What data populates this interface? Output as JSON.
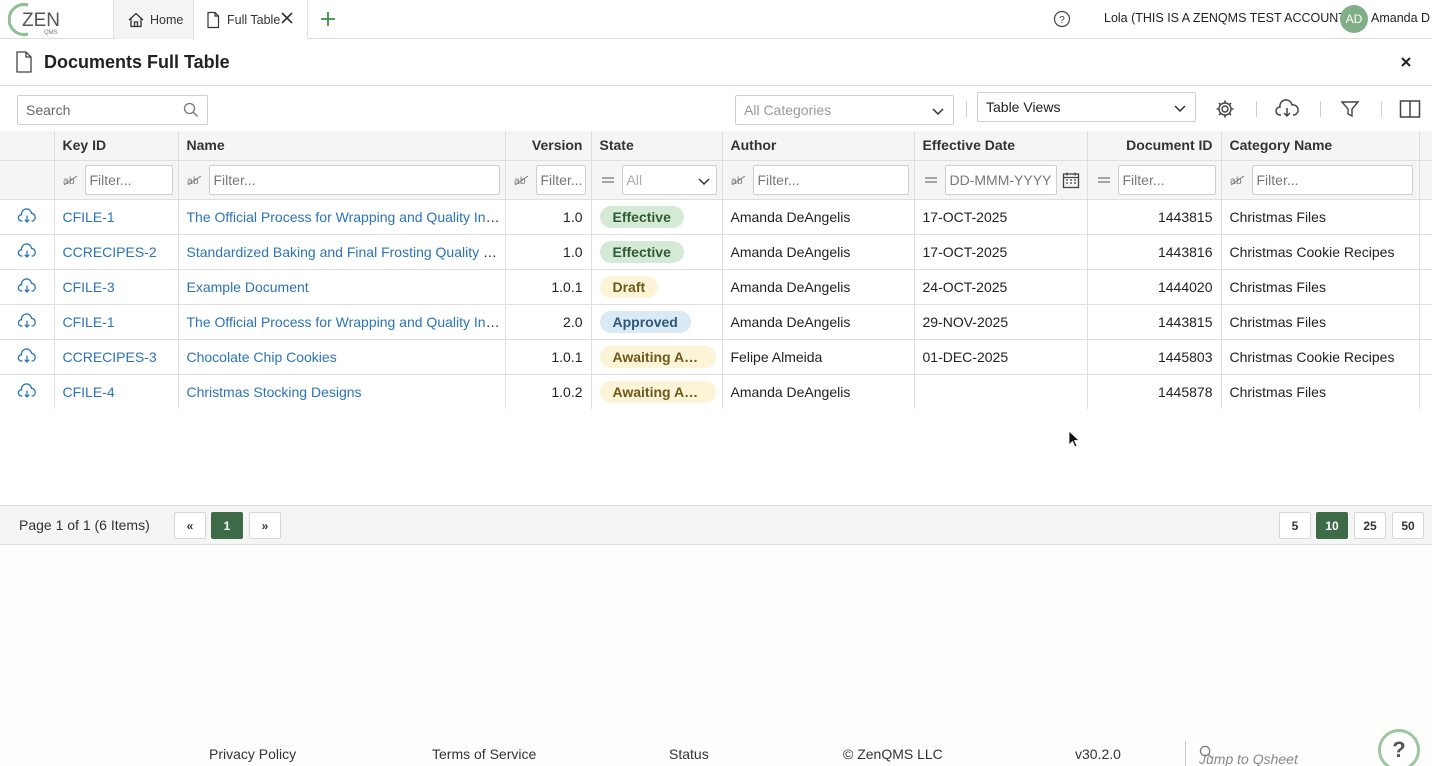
{
  "topbar": {
    "logo_text": "ZEN",
    "logo_sub": "QMS",
    "tabs": [
      {
        "label": "Home",
        "icon": "home-icon"
      },
      {
        "label": "Full Table",
        "icon": "document-icon"
      }
    ],
    "account": "Lola (THIS IS A ZENQMS TEST ACCOUNT)",
    "avatar_initials": "AD",
    "username": "Amanda D"
  },
  "page": {
    "title": "Documents Full Table"
  },
  "toolbar": {
    "search_placeholder": "Search",
    "categories_placeholder": "All Categories",
    "table_views_label": "Table Views"
  },
  "grid": {
    "columns": [
      "Key ID",
      "Name",
      "Version",
      "State",
      "Author",
      "Effective Date",
      "Document ID",
      "Category Name"
    ],
    "filters": {
      "text_placeholder": "Filter...",
      "state_placeholder": "All",
      "date_placeholder": "DD-MMM-YYYY"
    },
    "rows": [
      {
        "key_id": "CFILE-1",
        "name": "The Official Process for Wrapping and Quality Inspection of Christmas Gifts",
        "version": "1.0",
        "state": "Effective",
        "author": "Amanda DeAngelis",
        "effective_date": "17-OCT-2025",
        "document_id": "1443815",
        "category": "Christmas Files"
      },
      {
        "key_id": "CCRECIPES-2",
        "name": "Standardized Baking and Final Frosting Quality Check",
        "version": "1.0",
        "state": "Effective",
        "author": "Amanda DeAngelis",
        "effective_date": "17-OCT-2025",
        "document_id": "1443816",
        "category": "Christmas Cookie Recipes"
      },
      {
        "key_id": "CFILE-3",
        "name": "Example Document",
        "version": "1.0.1",
        "state": "Draft",
        "author": "Amanda DeAngelis",
        "effective_date": "24-OCT-2025",
        "document_id": "1444020",
        "category": "Christmas Files"
      },
      {
        "key_id": "CFILE-1",
        "name": "The Official Process for Wrapping and Quality Inspection of Christmas Gifts",
        "version": "2.0",
        "state": "Approved",
        "author": "Amanda DeAngelis",
        "effective_date": "29-NOV-2025",
        "document_id": "1443815",
        "category": "Christmas Files"
      },
      {
        "key_id": "CCRECIPES-3",
        "name": "Chocolate Chip Cookies",
        "version": "1.0.1",
        "state": "Awaiting Approval",
        "author": "Felipe Almeida",
        "effective_date": "01-DEC-2025",
        "document_id": "1445803",
        "category": "Christmas Cookie Recipes"
      },
      {
        "key_id": "CFILE-4",
        "name": "Christmas Stocking Designs",
        "version": "1.0.2",
        "state": "Awaiting Approval",
        "author": "Amanda DeAngelis",
        "effective_date": "",
        "document_id": "1445878",
        "category": "Christmas Files"
      }
    ],
    "state_colors": {
      "Effective": {
        "bg": "#d5ead6",
        "fg": "#2e5a35"
      },
      "Draft": {
        "bg": "#fbf4d6",
        "fg": "#6b5a1c"
      },
      "Approved": {
        "bg": "#d9e9f6",
        "fg": "#2d5878"
      },
      "Awaiting Approval": {
        "bg": "#fbf4d6",
        "fg": "#6b5a1c"
      }
    }
  },
  "pager": {
    "info": "Page 1 of 1 (6 Items)",
    "first": "«",
    "current": "1",
    "last": "»",
    "sizes": [
      "5",
      "10",
      "25",
      "50"
    ],
    "active_size": "10"
  },
  "footer": {
    "links": [
      "Privacy Policy",
      "Terms of Service",
      "Status"
    ],
    "copyright": "© ZenQMS LLC",
    "version": "v30.2.0",
    "jump_placeholder": "Jump to Qsheet"
  },
  "colors": {
    "accent": "#3d6b47",
    "link": "#2b74b7"
  }
}
